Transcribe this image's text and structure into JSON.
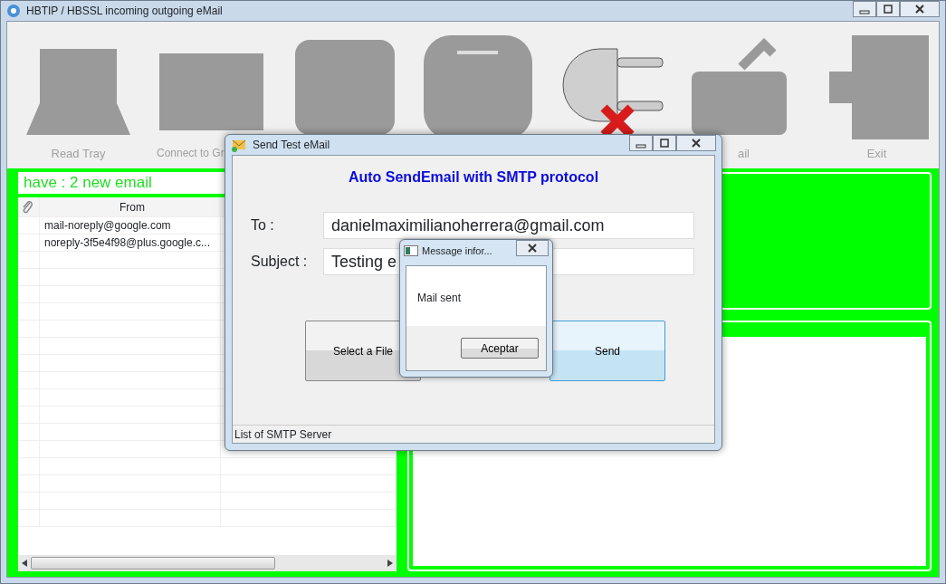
{
  "window": {
    "title": "HBTIP / HBSSL incoming outgoing eMail"
  },
  "toolbar": [
    {
      "label": "Read Tray",
      "kind": "tray"
    },
    {
      "label": "Connect to Gr",
      "kind": "screen"
    },
    {
      "kind": "mail"
    },
    {
      "kind": "round"
    },
    {
      "kind": "plug"
    },
    {
      "label": "ail",
      "kind": "send"
    },
    {
      "label": "Exit",
      "kind": "exit"
    }
  ],
  "inbox": {
    "header": "have : 2 new email",
    "columns": [
      "From"
    ],
    "rows": [
      {
        "from": "mail-noreply@google.com"
      },
      {
        "from": "noreply-3f5e4f98@plus.google.c..."
      }
    ]
  },
  "send_window": {
    "title": "Send Test eMail",
    "heading": "Auto SendEmail with SMTP protocol",
    "fields": [
      {
        "label": "To :",
        "value": "danielmaximilianoherrera@gmail.com"
      },
      {
        "label": "Subject :",
        "value": "Testing e"
      }
    ],
    "buttons": [
      {
        "label": "Select a File",
        "selected": false
      },
      {
        "label": "Send",
        "selected": true
      }
    ],
    "status_bar": "List of SMTP Server"
  },
  "message_box": {
    "title": "Message infor...",
    "message": "Mail sent",
    "button": "Aceptar"
  }
}
